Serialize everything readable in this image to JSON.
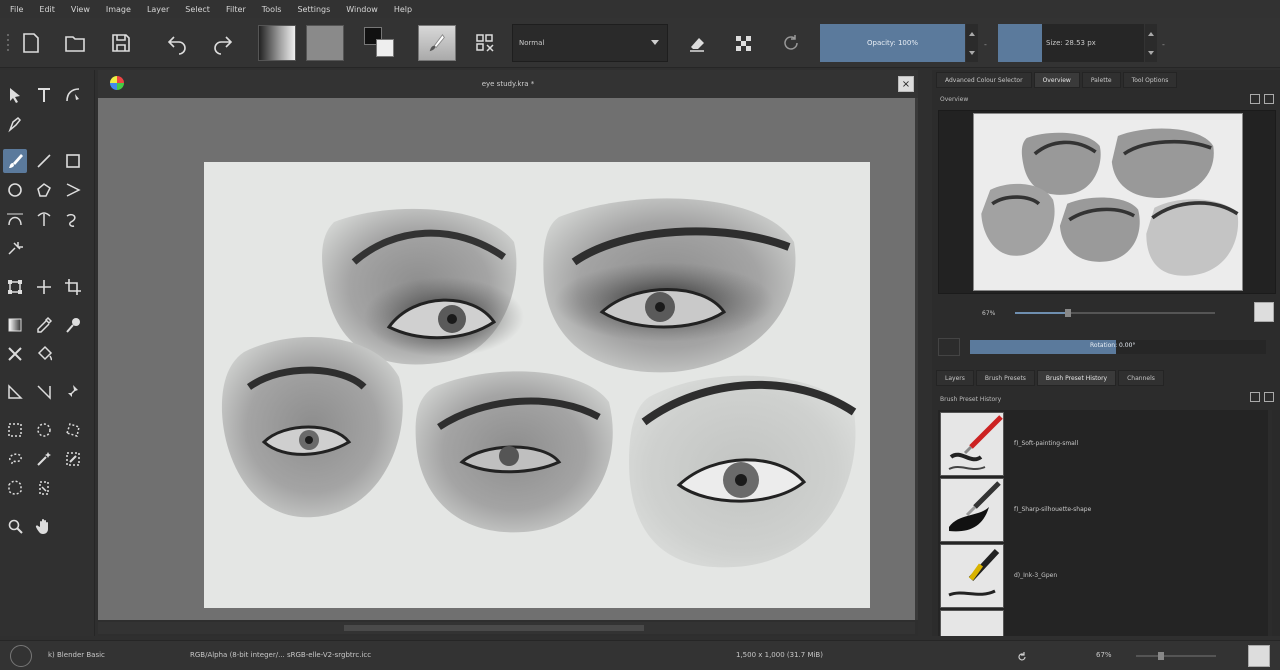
{
  "menu": [
    "File",
    "Edit",
    "View",
    "Image",
    "Layer",
    "Select",
    "Filter",
    "Tools",
    "Settings",
    "Window",
    "Help"
  ],
  "toolbar": {
    "blend_mode": "Normal",
    "opacity_label": "Opacity: 100%",
    "size_label": "Size: 28.53 px",
    "dash": "-"
  },
  "document": {
    "title": "eye study.kra *",
    "close_glyph": "×"
  },
  "docker": {
    "tabs_top": [
      "Advanced Colour Selector",
      "Overview",
      "Palette",
      "Tool Options"
    ],
    "active_top_tab": "Overview",
    "overview_label": "Overview",
    "zoom_percent": "67%",
    "rotation_label": "Rotation: 0.00°",
    "tabs_bottom": [
      "Layers",
      "Brush Presets",
      "Brush Preset History",
      "Channels"
    ],
    "active_bottom_tab": "Brush Preset History",
    "history_label": "Brush Preset History",
    "presets": [
      "f)_Soft-painting-small",
      "f)_Sharp-silhouette-shape",
      "d)_Ink-3_Gpen"
    ]
  },
  "status": {
    "brush_preset": "k) Blender Basic",
    "color_space": "RGB/Alpha (8-bit integer/... sRGB-elle-V2-srgbtrc.icc",
    "image_size": "1,500 x 1,000 (31.7 MiB)",
    "zoom": "67%"
  }
}
